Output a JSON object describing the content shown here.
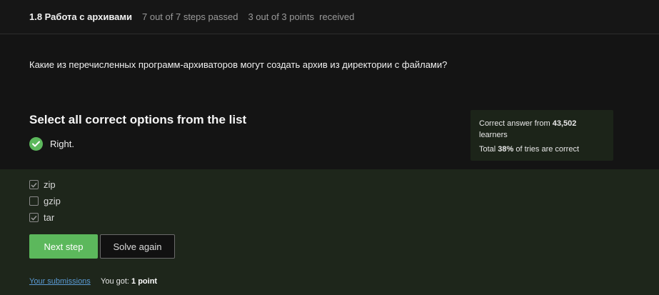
{
  "header": {
    "lesson_title": "1.8 Работа с архивами",
    "steps_status": "7 out of 7 steps passed",
    "points_status": "3 out of 3 points  received"
  },
  "question": {
    "text": "Какие из перечисленных программ-архиваторов могут создать архив из директории с файлами?"
  },
  "answer": {
    "instruction": "Select all correct options from the list",
    "result_text": "Right.",
    "result_icon": "check-circle-icon",
    "accent_color": "#5cb85c"
  },
  "stats": {
    "prefix1": "Correct answer from ",
    "learners_count": "43,502",
    "suffix1": "learners",
    "prefix2": "Total ",
    "percent": "38%",
    "suffix2": " of tries are correct"
  },
  "options": [
    {
      "label": "zip",
      "checked": true
    },
    {
      "label": "gzip",
      "checked": false
    },
    {
      "label": "tar",
      "checked": true
    }
  ],
  "actions": {
    "next_label": "Next step",
    "solve_again_label": "Solve again"
  },
  "footer": {
    "submissions_link": "Your submissions",
    "got_prefix": "You got: ",
    "got_value": "1 point"
  }
}
